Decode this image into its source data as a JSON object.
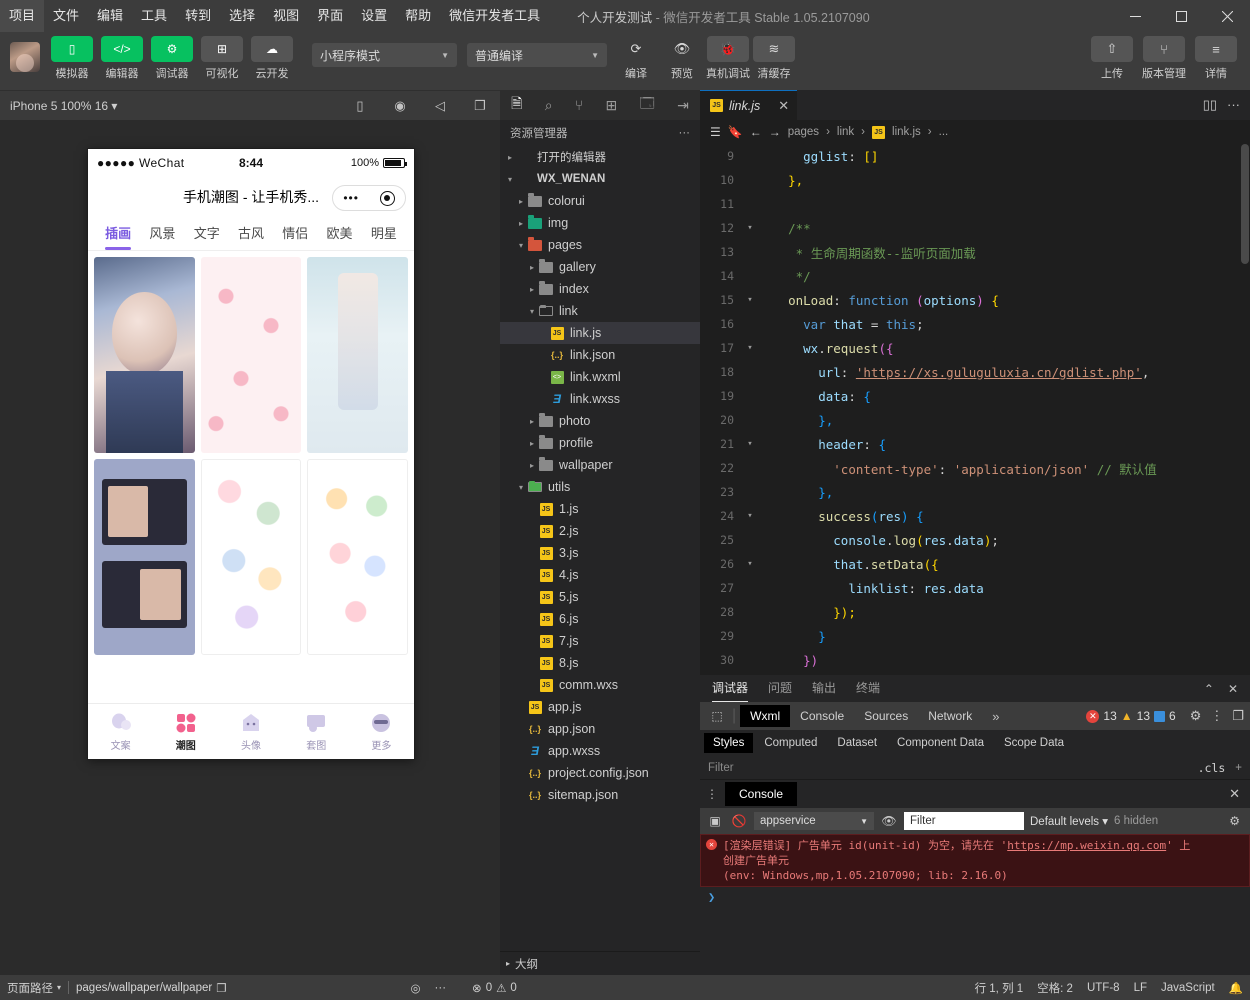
{
  "menubar": {
    "items": [
      "项目",
      "文件",
      "编辑",
      "工具",
      "转到",
      "选择",
      "视图",
      "界面",
      "设置",
      "帮助",
      "微信开发者工具"
    ],
    "window_title_strong": "个人开发测试",
    "window_title_rest": "- 微信开发者工具 Stable 1.05.2107090",
    "minimize": "—",
    "maximize": "▢",
    "close": "✕"
  },
  "toolbar": {
    "items": [
      {
        "label": "模拟器",
        "icon": "phone-icon",
        "glyph": "▯",
        "style": "green"
      },
      {
        "label": "编辑器",
        "icon": "code-icon",
        "glyph": "</>",
        "style": "green"
      },
      {
        "label": "调试器",
        "icon": "sliders-icon",
        "glyph": "⚙",
        "style": "green"
      },
      {
        "label": "可视化",
        "icon": "layout-icon",
        "glyph": "⊞",
        "style": "grey"
      },
      {
        "label": "云开发",
        "icon": "cloud-icon",
        "glyph": "☁",
        "style": "grey"
      }
    ],
    "mode_select": "小程序模式",
    "compile_select": "普通编译",
    "actions": [
      {
        "label": "编译",
        "icon": "refresh-icon",
        "glyph": "⟳"
      },
      {
        "label": "预览",
        "icon": "eye-icon",
        "glyph": "👁"
      },
      {
        "label": "真机调试",
        "icon": "bug-icon",
        "glyph": "🐞"
      },
      {
        "label": "清缓存",
        "icon": "layers-icon",
        "glyph": "≋"
      }
    ],
    "right_actions": [
      {
        "label": "上传",
        "icon": "upload-icon",
        "glyph": "⇧"
      },
      {
        "label": "版本管理",
        "icon": "branch-icon",
        "glyph": "⑂"
      },
      {
        "label": "详情",
        "icon": "menu-icon",
        "glyph": "≡"
      }
    ]
  },
  "simulator": {
    "device_label": "iPhone 5 100% 16",
    "bar_icons": [
      "phone-icon",
      "record-icon",
      "volume-icon",
      "window-icon"
    ],
    "status": {
      "carrier": "●●●●● WeChat",
      "time": "8:44",
      "battery": "100%"
    },
    "nav_title": "手机潮图 - 让手机秀...",
    "categories": [
      "插画",
      "风景",
      "文字",
      "古风",
      "情侣",
      "欧美",
      "明星"
    ],
    "active_category": "插画",
    "tabbar": [
      {
        "label": "文案",
        "icon": "balloon-icon"
      },
      {
        "label": "潮图",
        "icon": "grid-icon"
      },
      {
        "label": "头像",
        "icon": "ghost-icon"
      },
      {
        "label": "套图",
        "icon": "frame-icon"
      },
      {
        "label": "更多",
        "icon": "smiley-icon"
      }
    ],
    "active_tab": "潮图"
  },
  "explorer": {
    "activity_icons": [
      "files-icon",
      "search-icon",
      "source-control-icon",
      "extensions-icon",
      "debug-icon",
      "collapse-icon"
    ],
    "title": "资源管理器",
    "more": "···",
    "tree": [
      {
        "label": "打开的编辑器",
        "depth": 0,
        "type": "section",
        "arrow": "▸"
      },
      {
        "label": "WX_WENAN",
        "depth": 0,
        "type": "root",
        "arrow": "▾"
      },
      {
        "label": "colorui",
        "depth": 1,
        "type": "folder",
        "arrow": "▸",
        "color": "grey"
      },
      {
        "label": "img",
        "depth": 1,
        "type": "folder",
        "arrow": "▸",
        "color": "green"
      },
      {
        "label": "pages",
        "depth": 1,
        "type": "folder",
        "arrow": "▾",
        "color": "red"
      },
      {
        "label": "gallery",
        "depth": 2,
        "type": "folder",
        "arrow": "▸",
        "color": "grey"
      },
      {
        "label": "index",
        "depth": 2,
        "type": "folder",
        "arrow": "▸",
        "color": "grey"
      },
      {
        "label": "link",
        "depth": 2,
        "type": "folder",
        "arrow": "▾",
        "color": "grey",
        "open": true
      },
      {
        "label": "link.js",
        "depth": 3,
        "type": "js",
        "selected": true
      },
      {
        "label": "link.json",
        "depth": 3,
        "type": "json"
      },
      {
        "label": "link.wxml",
        "depth": 3,
        "type": "wxml"
      },
      {
        "label": "link.wxss",
        "depth": 3,
        "type": "wxss"
      },
      {
        "label": "photo",
        "depth": 2,
        "type": "folder",
        "arrow": "▸",
        "color": "grey"
      },
      {
        "label": "profile",
        "depth": 2,
        "type": "folder",
        "arrow": "▸",
        "color": "grey"
      },
      {
        "label": "wallpaper",
        "depth": 2,
        "type": "folder",
        "arrow": "▸",
        "color": "grey"
      },
      {
        "label": "utils",
        "depth": 1,
        "type": "folder",
        "arrow": "▾",
        "color": "lgreen",
        "open": true
      },
      {
        "label": "1.js",
        "depth": 2,
        "type": "js"
      },
      {
        "label": "2.js",
        "depth": 2,
        "type": "js"
      },
      {
        "label": "3.js",
        "depth": 2,
        "type": "js"
      },
      {
        "label": "4.js",
        "depth": 2,
        "type": "js"
      },
      {
        "label": "5.js",
        "depth": 2,
        "type": "js"
      },
      {
        "label": "6.js",
        "depth": 2,
        "type": "js"
      },
      {
        "label": "7.js",
        "depth": 2,
        "type": "js"
      },
      {
        "label": "8.js",
        "depth": 2,
        "type": "js"
      },
      {
        "label": "comm.wxs",
        "depth": 2,
        "type": "js"
      },
      {
        "label": "app.js",
        "depth": 1,
        "type": "js"
      },
      {
        "label": "app.json",
        "depth": 1,
        "type": "json"
      },
      {
        "label": "app.wxss",
        "depth": 1,
        "type": "wxss"
      },
      {
        "label": "project.config.json",
        "depth": 1,
        "type": "json"
      },
      {
        "label": "sitemap.json",
        "depth": 1,
        "type": "json"
      }
    ],
    "outline": "大纲"
  },
  "editor": {
    "tab_name": "link.js",
    "tab_close": "✕",
    "split_icon": "split-editor-icon",
    "more_icon": "more-icon",
    "breadcrumb": [
      "pages",
      "link",
      "link.js",
      "..."
    ],
    "first_line_number": 9,
    "lines": [
      {
        "n": 9,
        "fold": "",
        "html": "      <span class='k-key'>gglist</span><span class='k-pl'>:</span> <span class='k-br1'>[]</span>"
      },
      {
        "n": 10,
        "fold": "",
        "html": "    <span class='k-br1'>},</span>"
      },
      {
        "n": 11,
        "fold": "",
        "html": ""
      },
      {
        "n": 12,
        "fold": "▾",
        "html": "    <span class='k-cm'>/**</span>"
      },
      {
        "n": 13,
        "fold": "",
        "html": "     <span class='k-cm'>* 生命周期函数--监听页面加载</span>"
      },
      {
        "n": 14,
        "fold": "",
        "html": "     <span class='k-cm'>*/</span>"
      },
      {
        "n": 15,
        "fold": "▾",
        "html": "    <span class='k-fn'>onLoad</span><span class='k-pl'>:</span> <span class='k-kw'>function</span> <span class='k-br2'>(</span><span class='k-prm'>options</span><span class='k-br2'>)</span> <span class='k-br1'>{</span>"
      },
      {
        "n": 16,
        "fold": "",
        "html": "      <span class='k-kw'>var</span> <span class='k-key'>that</span> <span class='k-pl'>=</span> <span class='k-kw'>this</span><span class='k-pl'>;</span>"
      },
      {
        "n": 17,
        "fold": "▾",
        "html": "      <span class='k-key'>wx</span><span class='k-pl'>.</span><span class='k-fn'>request</span><span class='k-br2'>({</span>"
      },
      {
        "n": 18,
        "fold": "",
        "html": "        <span class='k-key'>url</span><span class='k-pl'>:</span> <span class='k-lnk'>'https://xs.guluguluxia.cn/gdlist.php'</span><span class='k-pl'>,</span>"
      },
      {
        "n": 19,
        "fold": "",
        "html": "        <span class='k-key'>data</span><span class='k-pl'>:</span> <span class='k-br3'>{</span>"
      },
      {
        "n": 20,
        "fold": "",
        "html": "        <span class='k-br3'>},</span>"
      },
      {
        "n": 21,
        "fold": "▾",
        "html": "        <span class='k-key'>header</span><span class='k-pl'>:</span> <span class='k-br3'>{</span>"
      },
      {
        "n": 22,
        "fold": "",
        "html": "          <span class='k-str'>'content-type'</span><span class='k-pl'>:</span> <span class='k-str'>'application/json'</span> <span class='k-cm'>// 默认值</span>"
      },
      {
        "n": 23,
        "fold": "",
        "html": "        <span class='k-br3'>},</span>"
      },
      {
        "n": 24,
        "fold": "▾",
        "html": "        <span class='k-fn'>success</span><span class='k-br3'>(</span><span class='k-prm'>res</span><span class='k-br3'>)</span> <span class='k-br3'>{</span>"
      },
      {
        "n": 25,
        "fold": "",
        "html": "          <span class='k-key'>console</span><span class='k-pl'>.</span><span class='k-fn'>log</span><span class='k-br1'>(</span><span class='k-key'>res</span><span class='k-pl'>.</span><span class='k-key'>data</span><span class='k-br1'>)</span><span class='k-pl'>;</span>"
      },
      {
        "n": 26,
        "fold": "▾",
        "html": "          <span class='k-key'>that</span><span class='k-pl'>.</span><span class='k-fn'>setData</span><span class='k-br1'>({</span>"
      },
      {
        "n": 27,
        "fold": "",
        "html": "            <span class='k-key'>linklist</span><span class='k-pl'>:</span> <span class='k-key'>res</span><span class='k-pl'>.</span><span class='k-key'>data</span>"
      },
      {
        "n": 28,
        "fold": "",
        "html": "          <span class='k-br1'>});</span>"
      },
      {
        "n": 29,
        "fold": "",
        "html": "        <span class='k-br3'>}</span>"
      },
      {
        "n": 30,
        "fold": "",
        "html": "      <span class='k-br2'>})</span>"
      }
    ]
  },
  "debugger": {
    "panel_tabs": [
      "调试器",
      "问题",
      "输出",
      "终端"
    ],
    "panel_active": "调试器",
    "panel_collapse": "⌃",
    "panel_close": "✕",
    "devtools_tabs": [
      "Wxml",
      "Console",
      "Sources",
      "Network"
    ],
    "devtools_active": "Wxml",
    "devtools_more": "»",
    "counts": {
      "errors": "13",
      "warnings": "13",
      "info": "6"
    },
    "style_tabs": [
      "Styles",
      "Computed",
      "Dataset",
      "Component Data",
      "Scope Data"
    ],
    "style_active": "Styles",
    "filter_placeholder": "Filter",
    "cls_label": ".cls",
    "plus": "+",
    "console": {
      "tab": "Console",
      "close": "✕",
      "context": "appservice",
      "filter_placeholder": "Filter",
      "levels": "Default levels",
      "hidden": "6 hidden",
      "error_line1_pre": "[渲染层错误] 广告单元 id(unit-id) 为空，请先在 ",
      "error_link": "https://mp.weixin.qq.com",
      "error_line1_post": " 上",
      "error_line2": "创建广告单元",
      "error_line3": "(env: Windows,mp,1.05.2107090; lib: 2.16.0)",
      "prompt": "❯"
    }
  },
  "statusbar": {
    "page_path_label": "页面路径",
    "page_path_value": "pages/wallpaper/wallpaper",
    "copy_icon": "copy-icon",
    "eye_icon": "eye-icon",
    "more_icon": "more-icon",
    "errors": "0",
    "warnings": "0",
    "line_col": "行 1, 列 1",
    "spaces": "空格: 2",
    "encoding": "UTF-8",
    "eol": "LF",
    "language": "JavaScript",
    "bell": "🔔"
  }
}
